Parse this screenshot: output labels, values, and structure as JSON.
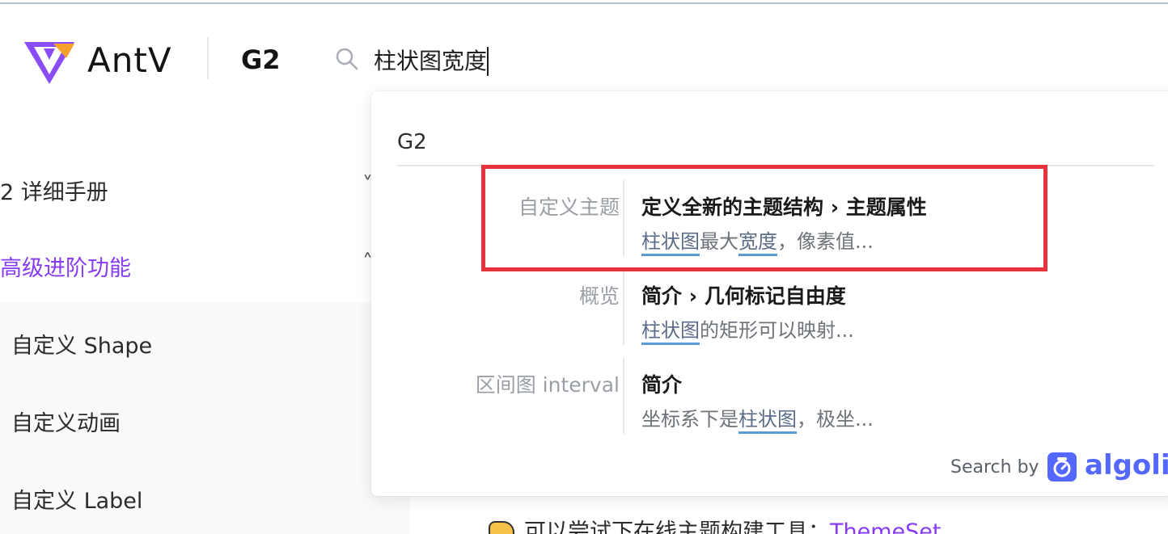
{
  "header": {
    "brand": "AntV",
    "product": "G2",
    "search_value": "柱状图宽度"
  },
  "sidebar": {
    "groups": [
      {
        "label": "2 详细手册"
      },
      {
        "label": "高级进阶功能"
      }
    ],
    "items": [
      {
        "label": "自定义 Shape"
      },
      {
        "label": "自定义动画"
      },
      {
        "label": "自定义 Label"
      }
    ]
  },
  "content": {
    "peek_text": "可以尝试下在线主题构建工具：",
    "peek_link": "ThemeSet"
  },
  "search_results": {
    "category": "G2",
    "results": [
      {
        "section": "自定义主题",
        "title": "定义全新的主题结构 › 主题属性",
        "snippet_parts": [
          "柱状图",
          "最大",
          "宽度",
          "，像素值..."
        ]
      },
      {
        "section": "概览",
        "title": "简介 › 几何标记自由度",
        "snippet_parts": [
          "柱状图",
          "的矩形可以映射..."
        ]
      },
      {
        "section": "区间图 interval",
        "title": "简介",
        "snippet_parts": [
          "坐标系下是",
          "柱状图",
          "，极坐..."
        ]
      }
    ],
    "search_by": "Search by",
    "provider": "algolia"
  },
  "colors": {
    "accent": "#873bf4",
    "highlight_box": "#e8323c",
    "algolia": "#5468ff",
    "match_underline": "#5b9bd5"
  }
}
